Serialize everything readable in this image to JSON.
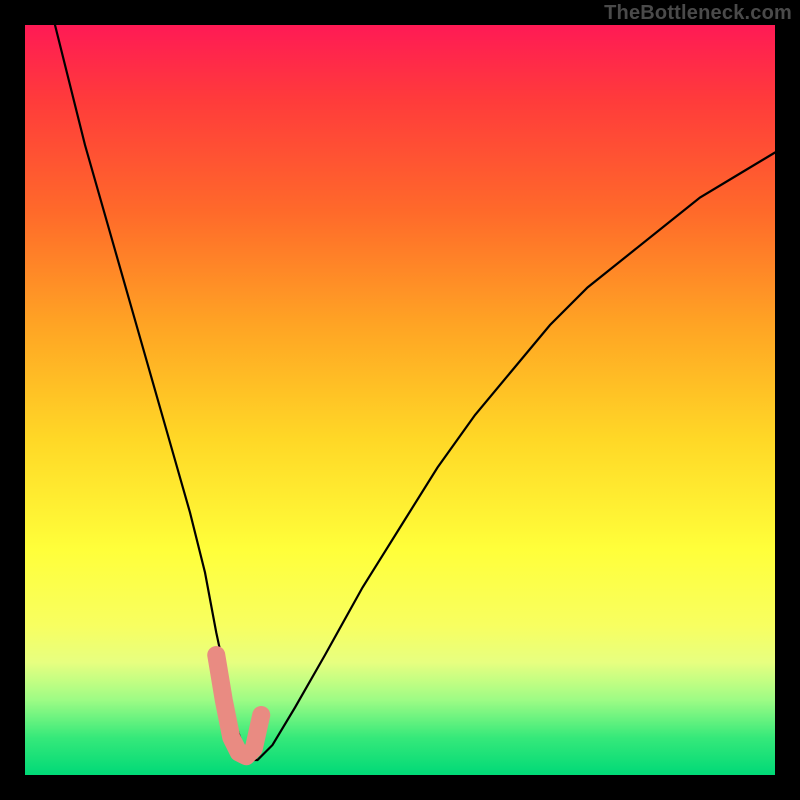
{
  "watermark": "TheBottleneck.com",
  "chart_data": {
    "type": "line",
    "title": "",
    "xlabel": "",
    "ylabel": "",
    "xlim": [
      0,
      100
    ],
    "ylim": [
      0,
      100
    ],
    "grid": false,
    "legend": false,
    "series": [
      {
        "name": "curve",
        "x": [
          4,
          6,
          8,
          10,
          12,
          14,
          16,
          18,
          20,
          22,
          24,
          25.5,
          27,
          28,
          29,
          30,
          31,
          33,
          36,
          40,
          45,
          50,
          55,
          60,
          65,
          70,
          75,
          80,
          85,
          90,
          95,
          100
        ],
        "values": [
          100,
          92,
          84,
          77,
          70,
          63,
          56,
          49,
          42,
          35,
          27,
          19,
          12,
          7,
          4,
          2,
          2,
          4,
          9,
          16,
          25,
          33,
          41,
          48,
          54,
          60,
          65,
          69,
          73,
          77,
          80,
          83
        ]
      },
      {
        "name": "highlight",
        "x": [
          25.5,
          26.5,
          27.5,
          28.5,
          29.5,
          30.5,
          31.5
        ],
        "values": [
          16,
          10,
          5,
          3,
          2.5,
          3.5,
          8
        ]
      }
    ],
    "colors": {
      "curve": "#000000",
      "highlight": "#e98b82"
    },
    "background_gradient": [
      "#ff1a55",
      "#ff3b3b",
      "#ff6a2a",
      "#ffa424",
      "#ffd726",
      "#ffff3a",
      "#f8ff60",
      "#e7ff80",
      "#9dfc85",
      "#36e97a",
      "#00d977"
    ]
  }
}
